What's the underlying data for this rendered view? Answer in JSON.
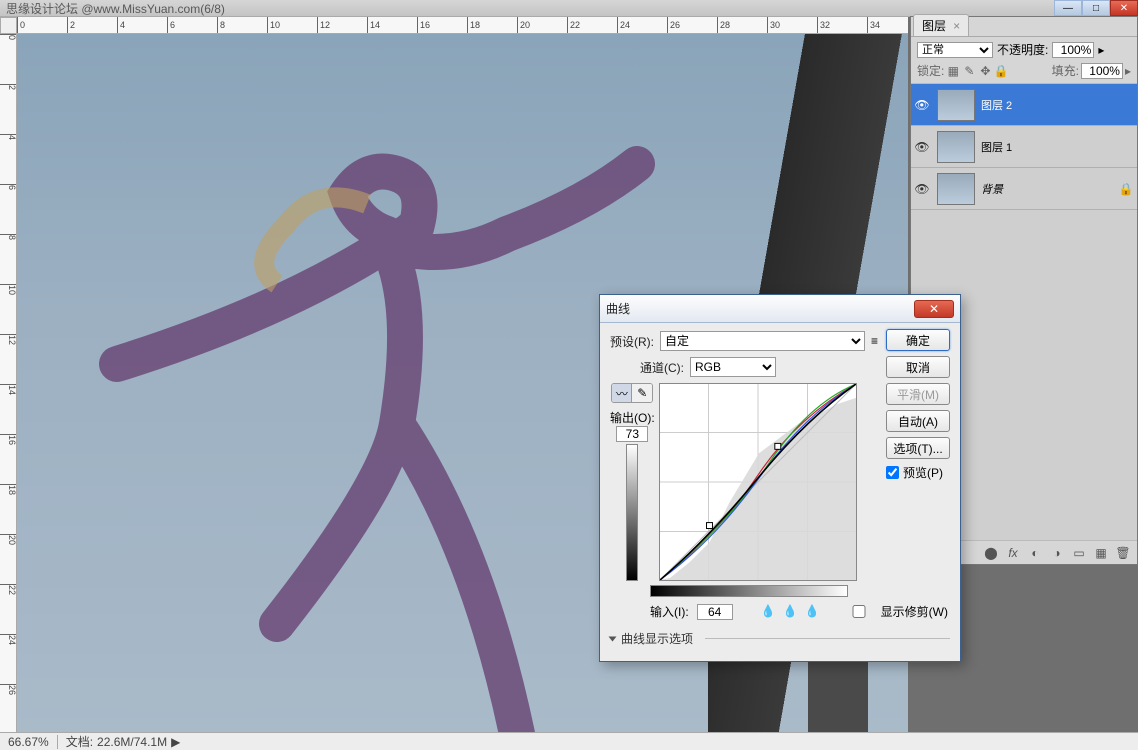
{
  "titleBar": "思缘设计论坛  @www.MissYuan.com(6/8)",
  "winControls": {
    "min": "—",
    "max": "□",
    "close": "✕"
  },
  "status": {
    "zoom": "66.67%",
    "docLabel": "文档:",
    "docValue": "22.6M/74.1M",
    "arrow": "▶"
  },
  "layersPanel": {
    "tab": "图层",
    "tabClose": "×",
    "blend": "正常",
    "opacityLabel": "不透明度:",
    "opacity": "100%",
    "lockLabel": "锁定:",
    "fillLabel": "填充:",
    "fill": "100%",
    "layers": [
      {
        "name": "图层 2",
        "selected": true,
        "locked": false
      },
      {
        "name": "图层 1",
        "selected": false,
        "locked": false
      },
      {
        "name": "背景",
        "selected": false,
        "locked": true
      }
    ]
  },
  "curvesDialog": {
    "title": "曲线",
    "presetLabel": "预设(R):",
    "presetValue": "自定",
    "channelLabel": "通道(C):",
    "channelValue": "RGB",
    "ok": "确定",
    "cancel": "取消",
    "smooth": "平滑(M)",
    "auto": "自动(A)",
    "options": "选项(T)...",
    "preview": "预览(P)",
    "outputLabel": "输出(O):",
    "outputValue": "73",
    "inputLabel": "输入(I):",
    "inputValue": "64",
    "showClipping": "显示修剪(W)",
    "displayOptions": "曲线显示选项"
  },
  "rulerH": [
    "0",
    "2",
    "4",
    "6",
    "8",
    "10",
    "12",
    "14",
    "16",
    "18",
    "20",
    "22",
    "24",
    "26",
    "28",
    "30",
    "32",
    "34"
  ],
  "rulerV": [
    "0",
    "2",
    "4",
    "6",
    "8",
    "10",
    "12",
    "14",
    "16",
    "18",
    "20",
    "22",
    "24",
    "26"
  ]
}
